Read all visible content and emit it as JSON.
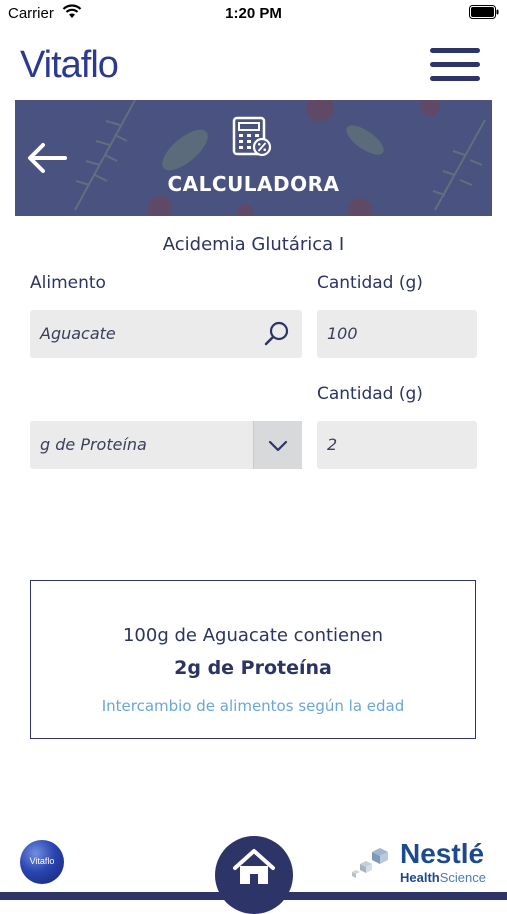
{
  "status_bar": {
    "carrier": "Carrier",
    "time": "1:20 PM"
  },
  "header": {
    "logo": "Vitaflo"
  },
  "banner": {
    "title": "CALCULADORA"
  },
  "page": {
    "subtitle": "Acidemia Glutárica I"
  },
  "form": {
    "food_label": "Alimento",
    "food_value": "Aguacate",
    "qty1_label": "Cantidad (g)",
    "qty1_value": "100",
    "qty2_label": "Cantidad (g)",
    "nutrient_value": "g de Proteína",
    "qty2_value": "2"
  },
  "result": {
    "line1": "100g de Aguacate contienen",
    "line2": "2g de Proteína",
    "link": "Intercambio de alimentos según la edad"
  },
  "footer": {
    "vitaflo_badge": "Vitaflo",
    "nestle_name": "Nestlé",
    "nestle_health": "Health",
    "nestle_science": "Science"
  },
  "colors": {
    "primary": "#2d3467",
    "banner": "#4a5280",
    "link": "#6aa6d6",
    "field": "#ebebec"
  }
}
